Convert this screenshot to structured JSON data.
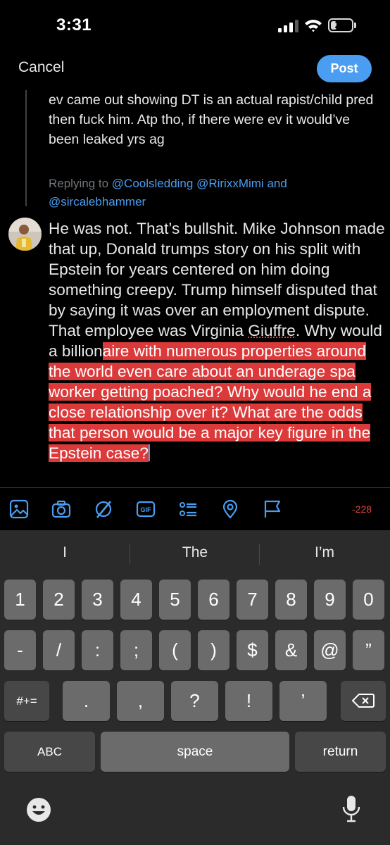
{
  "status_bar": {
    "time": "3:31",
    "battery": "27",
    "battery_percent": 27,
    "signal_bars": 3,
    "signal_bars_total": 4
  },
  "header": {
    "cancel_label": "Cancel",
    "post_label": "Post",
    "accent_color": "#4a9df0"
  },
  "quoted_tweet": {
    "text": "ev came out showing DT is an actual rapist/child pred then fuck him. Atp tho, if there were ev it would’ve been leaked yrs ag"
  },
  "replying_to": {
    "prefix": "Replying to",
    "handle_1": "@Coolsledding",
    "handle_2": "@RirixxMimi",
    "joiner": "and",
    "handle_3": "@sircalebhammer"
  },
  "draft": {
    "text_before": "He was not. That’s bullshit. Mike Johnson made that up, Donald trumps story on his split with Epstein for years centered on him doing something creepy. Trump himself disputed that by saying it was over an employment dispute. That employee was Virginia ",
    "misspelled_word": "Giuffre",
    "text_middle": ". Why would a billion",
    "selected_text": "aire with numerous properties around the world even care about an underage spa worker getting poached? Why would he end a close relationship over it? What are the odds that person would be a major key figure in the Epstein case?",
    "selection_color": "#dc3a3a"
  },
  "toolbar": {
    "icons": [
      "image-icon",
      "camera-icon",
      "grok-icon",
      "gif-icon",
      "poll-icon",
      "location-icon",
      "flag-icon"
    ],
    "gif_label": "GIF",
    "char_count": "-228"
  },
  "keyboard": {
    "suggestions": [
      "I",
      "The",
      "I’m"
    ],
    "row1": [
      "1",
      "2",
      "3",
      "4",
      "5",
      "6",
      "7",
      "8",
      "9",
      "0"
    ],
    "row2": [
      "-",
      "/",
      ":",
      ";",
      "(",
      ")",
      "$",
      "&",
      "@",
      "”"
    ],
    "row3_left": "#+=",
    "row3": [
      ".",
      ",",
      "?",
      "!",
      "’"
    ],
    "abc_label": "ABC",
    "space_label": "space",
    "return_label": "return"
  }
}
